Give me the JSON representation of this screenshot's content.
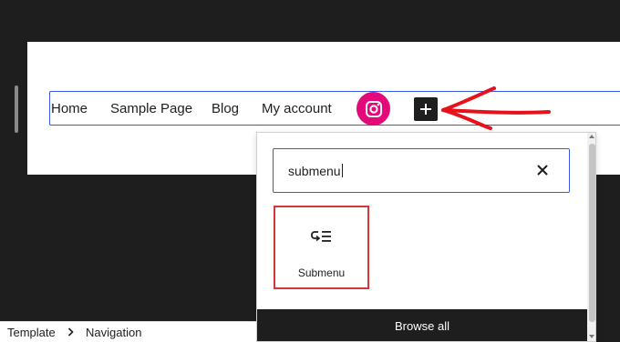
{
  "nav": {
    "items": [
      "Home",
      "Sample Page",
      "Blog",
      "My account"
    ],
    "social_icon": "instagram-icon",
    "add_button_icon": "plus-icon"
  },
  "annotation": {
    "arrow_color": "#e8101a"
  },
  "inserter": {
    "search_value": "submenu",
    "clear_icon": "close-icon",
    "result": {
      "label": "Submenu",
      "icon": "submenu-icon"
    },
    "browse_all_label": "Browse all"
  },
  "breadcrumb": {
    "items": [
      "Template",
      "Navigation"
    ],
    "separator_icon": "chevron-right-icon"
  },
  "colors": {
    "accent": "#3858e9",
    "instagram": "#e4097a",
    "highlight": "#d63638",
    "dark": "#1e1e1e"
  }
}
